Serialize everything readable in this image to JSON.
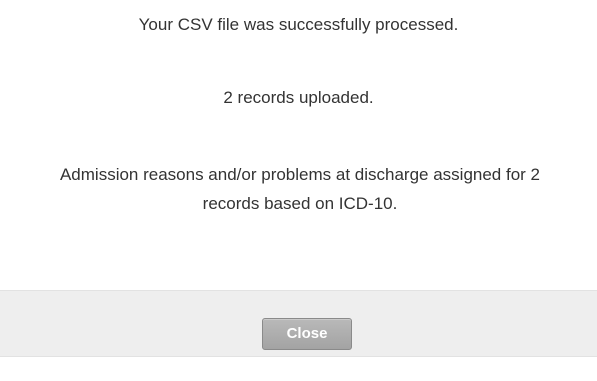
{
  "dialog": {
    "messages": {
      "processed": "Your CSV file was successfully processed.",
      "uploaded": "2 records uploaded.",
      "assigned": "Admission reasons and/or problems at discharge assigned for 2 records based on ICD-10."
    },
    "footer": {
      "close_label": "Close"
    }
  },
  "colors": {
    "text": "#333333",
    "footer_background": "#eeeeee",
    "button_background": "#a9a9a9"
  }
}
